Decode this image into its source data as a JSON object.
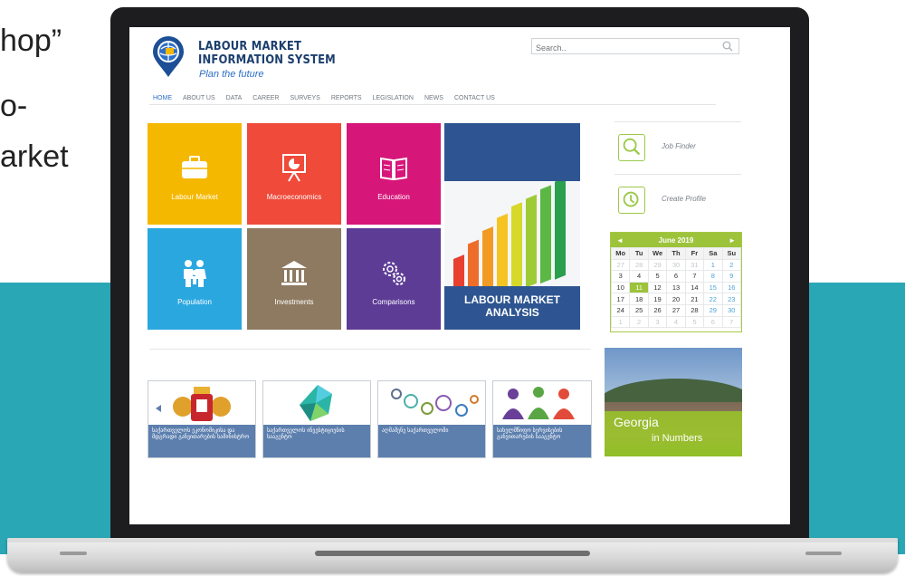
{
  "background": {
    "lines": [
      "hop”",
      "o-",
      "arket"
    ],
    "accent": "#2aa7b5"
  },
  "site": {
    "title_line1": "LABOUR MARKET",
    "title_line2": "INFORMATION SYSTEM",
    "tagline": "Plan the future",
    "search_placeholder": "Search..",
    "nav": [
      "HOME",
      "ABOUT US",
      "DATA",
      "CAREER",
      "SURVEYS",
      "REPORTS",
      "LEGISLATION",
      "NEWS",
      "CONTACT US"
    ],
    "brand_color": "#1c3f6e"
  },
  "tiles": [
    {
      "label": "Labour Market",
      "color": "#f5b800",
      "icon": "briefcase-icon"
    },
    {
      "label": "Macroeconomics",
      "color": "#ef4a3a",
      "icon": "presentation-chart-icon"
    },
    {
      "label": "Education",
      "color": "#d7167a",
      "icon": "book-icon"
    },
    {
      "label": "Population",
      "color": "#2ba7e0",
      "icon": "family-icon"
    },
    {
      "label": "Investments",
      "color": "#8e7a61",
      "icon": "bank-icon"
    },
    {
      "label": "Comparisons",
      "color": "#5d3c96",
      "icon": "gears-icon"
    }
  ],
  "analysis": {
    "line1": "LABOUR MARKET",
    "line2": "ANALYSIS"
  },
  "side": {
    "job_finder": "Job Finder",
    "create_profile": "Create Profile"
  },
  "calendar": {
    "month": "June 2019",
    "prev": "◄",
    "next": "►",
    "weekdays": [
      "Mo",
      "Tu",
      "We",
      "Th",
      "Fr",
      "Sa",
      "Su"
    ],
    "weeks": [
      [
        "27",
        "28",
        "29",
        "30",
        "31",
        "1",
        "2"
      ],
      [
        "3",
        "4",
        "5",
        "6",
        "7",
        "8",
        "9"
      ],
      [
        "10",
        "11",
        "12",
        "13",
        "14",
        "15",
        "16"
      ],
      [
        "17",
        "18",
        "19",
        "20",
        "21",
        "22",
        "23"
      ],
      [
        "24",
        "25",
        "26",
        "27",
        "28",
        "29",
        "30"
      ],
      [
        "1",
        "2",
        "3",
        "4",
        "5",
        "6",
        "7"
      ]
    ],
    "today": "11"
  },
  "georgia": {
    "line1": "Georgia",
    "line2": "in Numbers"
  },
  "cards": [
    {
      "text": "საქართველოს ეკონომიკისა და მდგრადი განვითარების სამინისტრო"
    },
    {
      "text": "საქართველოს ინვესტიციების სააგენტო"
    },
    {
      "text": "აღმაშენე საქართველოში"
    },
    {
      "text": "სახელმწიფო სერვისების განვითარების სააგენტო"
    }
  ]
}
